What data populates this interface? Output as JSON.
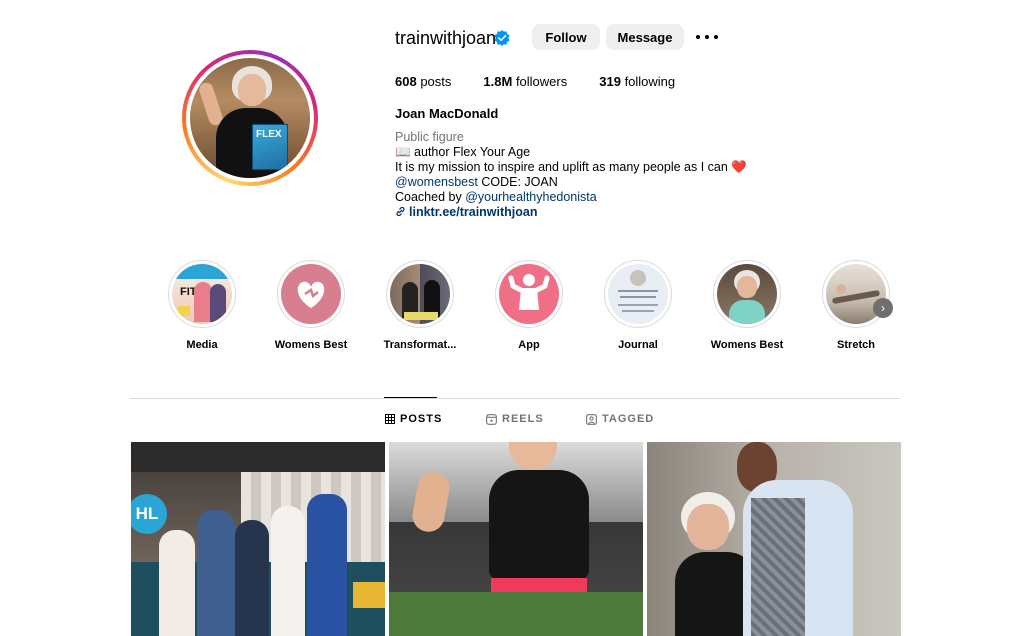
{
  "profile": {
    "username": "trainwithjoan",
    "follow_label": "Follow",
    "message_label": "Message",
    "stats": {
      "posts_value": "608",
      "posts_label": "posts",
      "followers_value": "1.8M",
      "followers_label": "followers",
      "following_value": "319",
      "following_label": "following"
    },
    "full_name": "Joan MacDonald",
    "category": "Public figure",
    "bio": {
      "line1": "📖 author Flex Your Age",
      "line2": "It is my mission to inspire and uplift as many people as I can",
      "line2_emoji": "❤️",
      "line3_mention": "@womensbest",
      "line3_rest": " CODE: JOAN",
      "line4_prefix": "Coached by ",
      "line4_mention": "@yourhealthyhedonista",
      "link": "linktr.ee/trainwithjoan"
    },
    "avatar_book_text": "FLEX"
  },
  "highlights": [
    {
      "label": "Media"
    },
    {
      "label": "Womens Best"
    },
    {
      "label": "Transformat..."
    },
    {
      "label": "App"
    },
    {
      "label": "Journal"
    },
    {
      "label": "Womens Best"
    },
    {
      "label": "Stretch"
    }
  ],
  "tabs": [
    {
      "label": "POSTS",
      "active": true
    },
    {
      "label": "REELS",
      "active": false
    },
    {
      "label": "TAGGED",
      "active": false
    }
  ],
  "posts": [
    {
      "overlay_text": "HL"
    },
    {
      "overlay_text": ""
    },
    {
      "overlay_text": ""
    }
  ],
  "colors": {
    "verified": "#0095f6",
    "link": "#00376b",
    "muted": "#737373",
    "button_bg": "#efefef",
    "heart": "#e0245e"
  }
}
